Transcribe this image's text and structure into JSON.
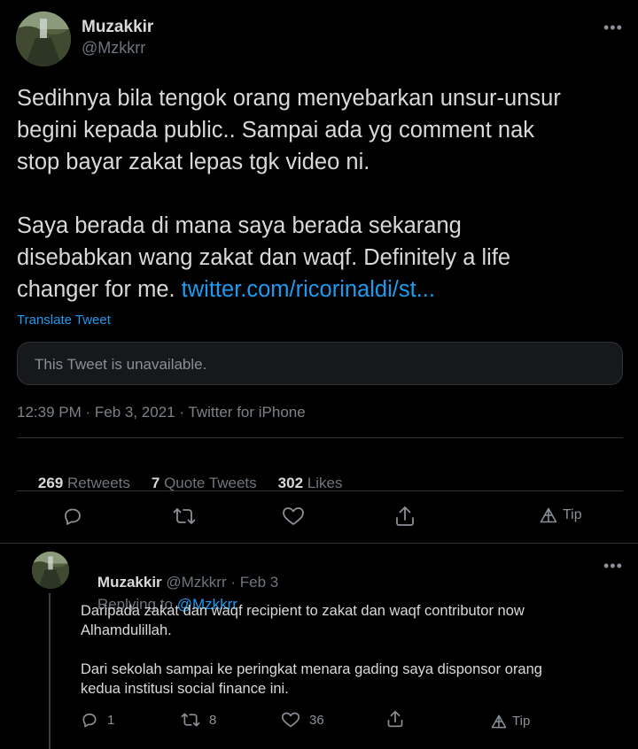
{
  "tweet": {
    "author_name": "Muzakkir",
    "author_handle": "@Mzkkrr",
    "more_icon": "more-horizontal-icon",
    "text_lines_1": [
      "Sedihnya bila tengok orang menyebarkan unsur-unsur",
      "begini kepada public.. Sampai ada yg comment nak",
      "stop bayar zakat lepas tgk video ni."
    ],
    "text_lines_2": [
      "Saya berada di mana saya berada sekarang",
      "disebabkan wang zakat dan waqf. Definitely a life"
    ],
    "text_line_last": "changer for me. ",
    "link_text": "twitter.com/ricorinaldi/st...",
    "translate": "Translate Tweet",
    "quoted_unavailable": "This Tweet is unavailable.",
    "meta": "12:39 PM · Feb 3, 2021 · Twitter for iPhone",
    "stats": {
      "retweets_count": "269",
      "retweets_label": " Retweets",
      "quotes_count": "7",
      "quotes_label": " Quote Tweets",
      "likes_count": "302",
      "likes_label": " Likes"
    },
    "actions": {
      "reply_icon": "reply-icon",
      "retweet_icon": "retweet-icon",
      "like_icon": "heart-icon",
      "share_icon": "share-icon",
      "tip_label": "Tip"
    }
  },
  "reply": {
    "author_name": "Muzakkir",
    "author_handle": "@Mzkkrr",
    "date": "· Feb 3",
    "replying_to_label": "Replying to ",
    "replying_to_handle": "@Mzkkrr",
    "text_lines_1": [
      "Daripada zakat dan waqf recipient to zakat dan waqf contributor now",
      "Alhamdulillah."
    ],
    "text_lines_2": [
      "Dari sekolah sampai ke peringkat menara gading saya disponsor orang",
      "kedua institusi social finance ini."
    ],
    "actions": {
      "reply_count": "1",
      "retweet_count": "8",
      "like_count": "36",
      "tip_label": "Tip"
    }
  },
  "colors": {
    "background": "#000000",
    "text": "#d9d9d9",
    "muted": "#6e767d",
    "link": "#1d9bf0",
    "border": "#2f3336"
  }
}
